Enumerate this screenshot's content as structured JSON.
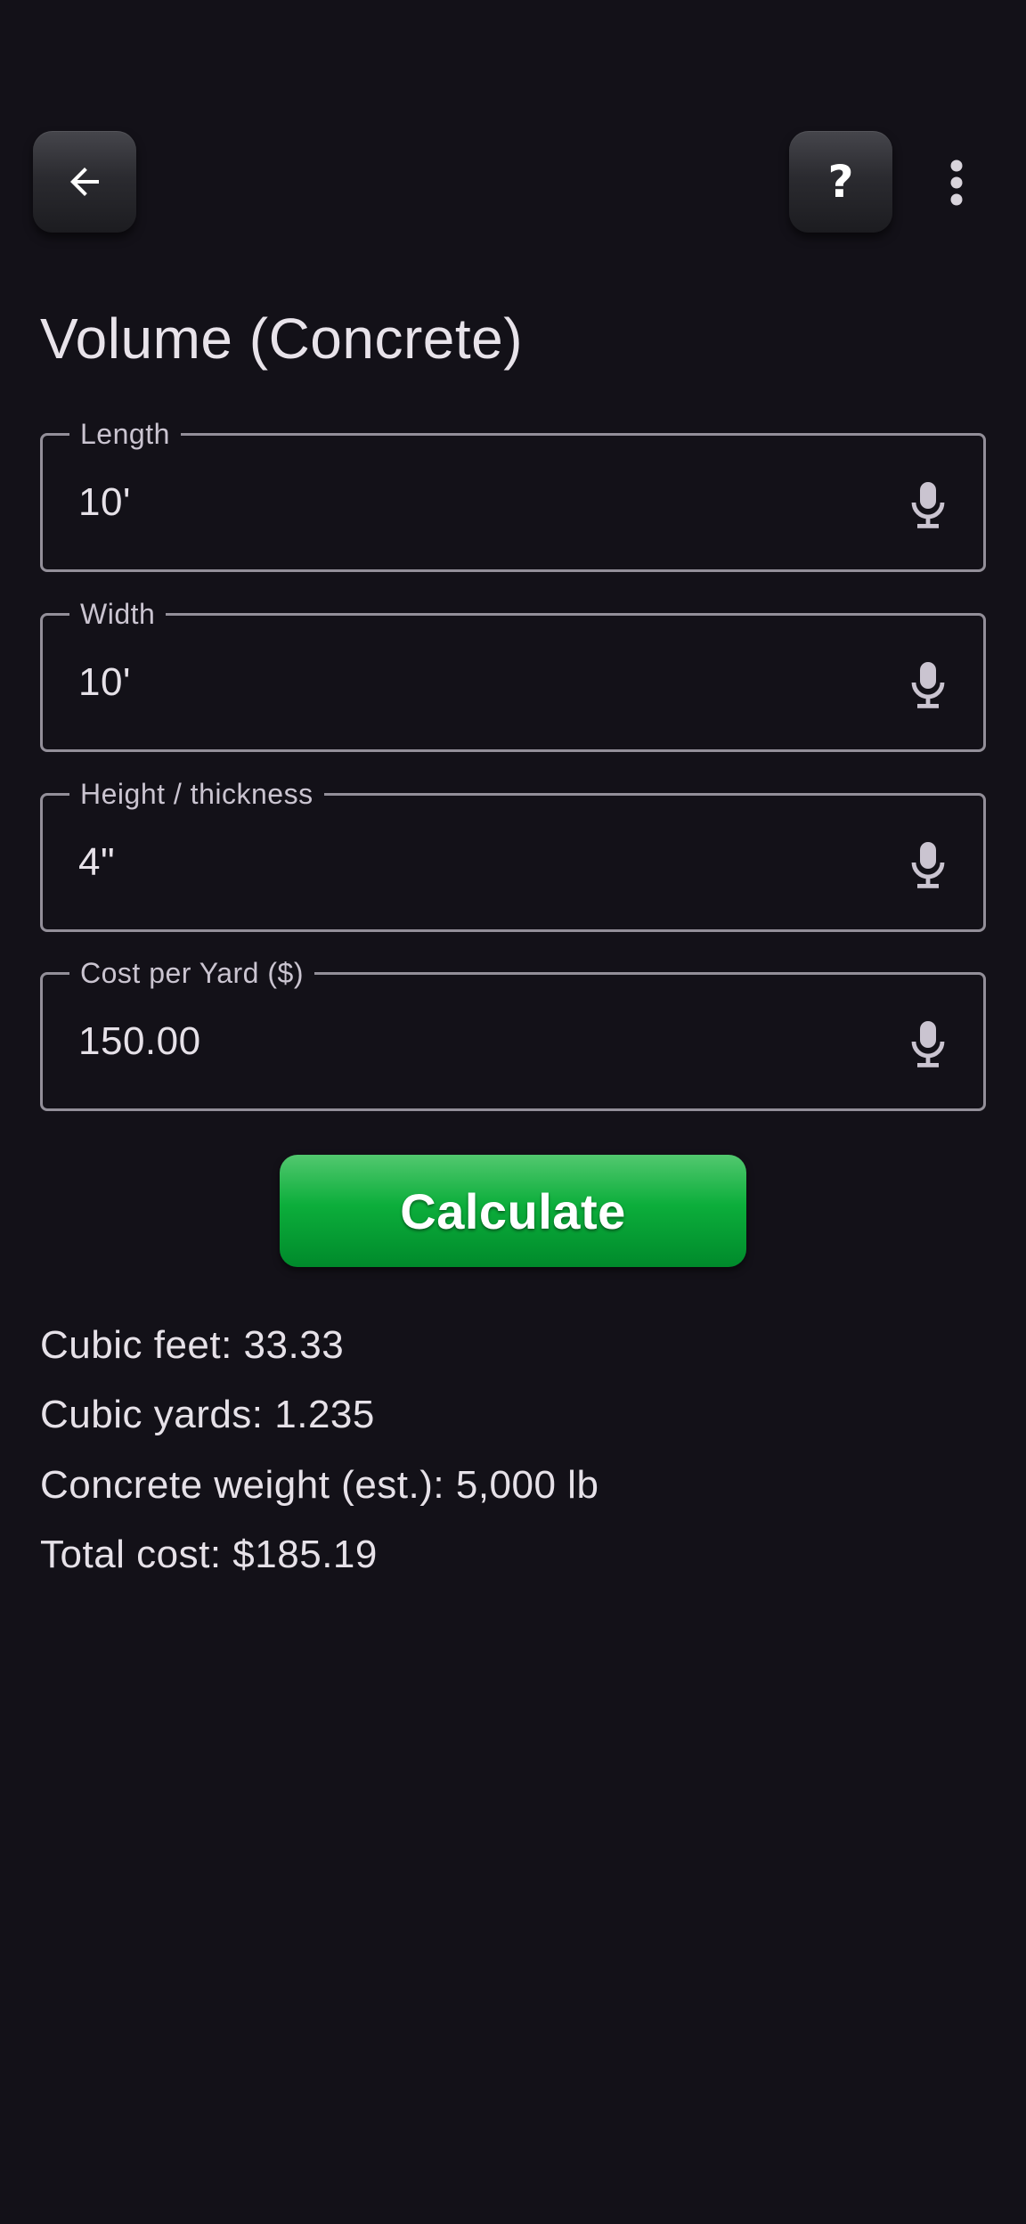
{
  "header": {
    "back_icon": "arrow-left-icon",
    "help_label": "?",
    "more_icon": "more-vertical-icon"
  },
  "page": {
    "title": "Volume (Concrete)"
  },
  "fields": [
    {
      "label": "Length",
      "value": "10'"
    },
    {
      "label": "Width",
      "value": "10'"
    },
    {
      "label": "Height / thickness",
      "value": "4\""
    },
    {
      "label": "Cost per Yard ($)",
      "value": "150.00"
    }
  ],
  "field_icon": "microphone-icon",
  "calculate_label": "Calculate",
  "results": [
    "Cubic feet: 33.33",
    "Cubic yards: 1.235",
    "Concrete weight (est.): 5,000 lb",
    "Total cost: $185.19"
  ],
  "colors": {
    "background": "#131118",
    "accent_green": "#0cae3b",
    "outline": "#938f99",
    "text": "#e6e1e8"
  }
}
